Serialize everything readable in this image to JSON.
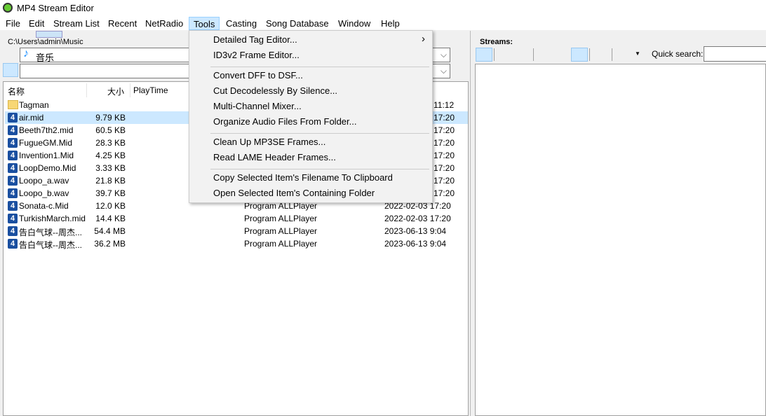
{
  "window": {
    "title": "MP4 Stream Editor"
  },
  "menubar": [
    "File",
    "Edit",
    "Stream List",
    "Recent",
    "NetRadio",
    "Tools",
    "Casting",
    "Song Database",
    "Window",
    "Help"
  ],
  "browser": {
    "path": "C:\\Users\\admin\\Music",
    "folder_combo": "音乐",
    "filter_value": ""
  },
  "columns": [
    "名称",
    "大小",
    "PlayTime"
  ],
  "files": [
    {
      "name": "Tagman",
      "size": "",
      "type": "",
      "date": "11:12",
      "kind": "folder"
    },
    {
      "name": "air.mid",
      "size": "9.79 KB",
      "type": "",
      "date": "17:20",
      "kind": "file",
      "selected": true
    },
    {
      "name": "Beeth7th2.mid",
      "size": "60.5 KB",
      "type": "",
      "date": "17:20",
      "kind": "file"
    },
    {
      "name": "FugueGM.Mid",
      "size": "28.3 KB",
      "type": "",
      "date": "17:20",
      "kind": "file"
    },
    {
      "name": "Invention1.Mid",
      "size": "4.25 KB",
      "type": "",
      "date": "17:20",
      "kind": "file"
    },
    {
      "name": "LoopDemo.Mid",
      "size": "3.33 KB",
      "type": "",
      "date": "17:20",
      "kind": "file"
    },
    {
      "name": "Loopo_a.wav",
      "size": "21.8 KB",
      "type": "",
      "date": "17:20",
      "kind": "file"
    },
    {
      "name": "Loopo_b.wav",
      "size": "39.7 KB",
      "type": "",
      "date": "17:20",
      "kind": "file"
    },
    {
      "name": "Sonata-c.Mid",
      "size": "12.0 KB",
      "type": "Program ALLPlayer",
      "date": "2022-02-03 17:20",
      "kind": "file"
    },
    {
      "name": "TurkishMarch.mid",
      "size": "14.4 KB",
      "type": "Program ALLPlayer",
      "date": "2022-02-03 17:20",
      "kind": "file"
    },
    {
      "name": "告白气球--周杰...",
      "size": "54.4 MB",
      "type": "Program ALLPlayer",
      "date": "2023-06-13 9:04",
      "kind": "file"
    },
    {
      "name": "告白气球--周杰...",
      "size": "36.2 MB",
      "type": "Program ALLPlayer",
      "date": "2023-06-13 9:04",
      "kind": "file"
    }
  ],
  "tools_menu": {
    "groups": [
      [
        "Detailed Tag Editor...",
        "ID3v2 Frame Editor..."
      ],
      [
        "Convert DFF to DSF...",
        "Cut Decodelessly By Silence...",
        "Multi-Channel Mixer...",
        "Organize Audio Files From Folder..."
      ],
      [
        "Clean Up MP3SE Frames...",
        "Read LAME Header Frames..."
      ],
      [
        "Copy Selected Item's Filename To Clipboard",
        "Open Selected Item's Containing Folder"
      ]
    ],
    "submenu_arrow": "›"
  },
  "streams": {
    "label": "Streams:",
    "quick_search_label": "Quick search:",
    "quick_search_value": ""
  },
  "colors": {
    "selection": "#cce8ff",
    "menu_bg": "#f2f2f2"
  }
}
